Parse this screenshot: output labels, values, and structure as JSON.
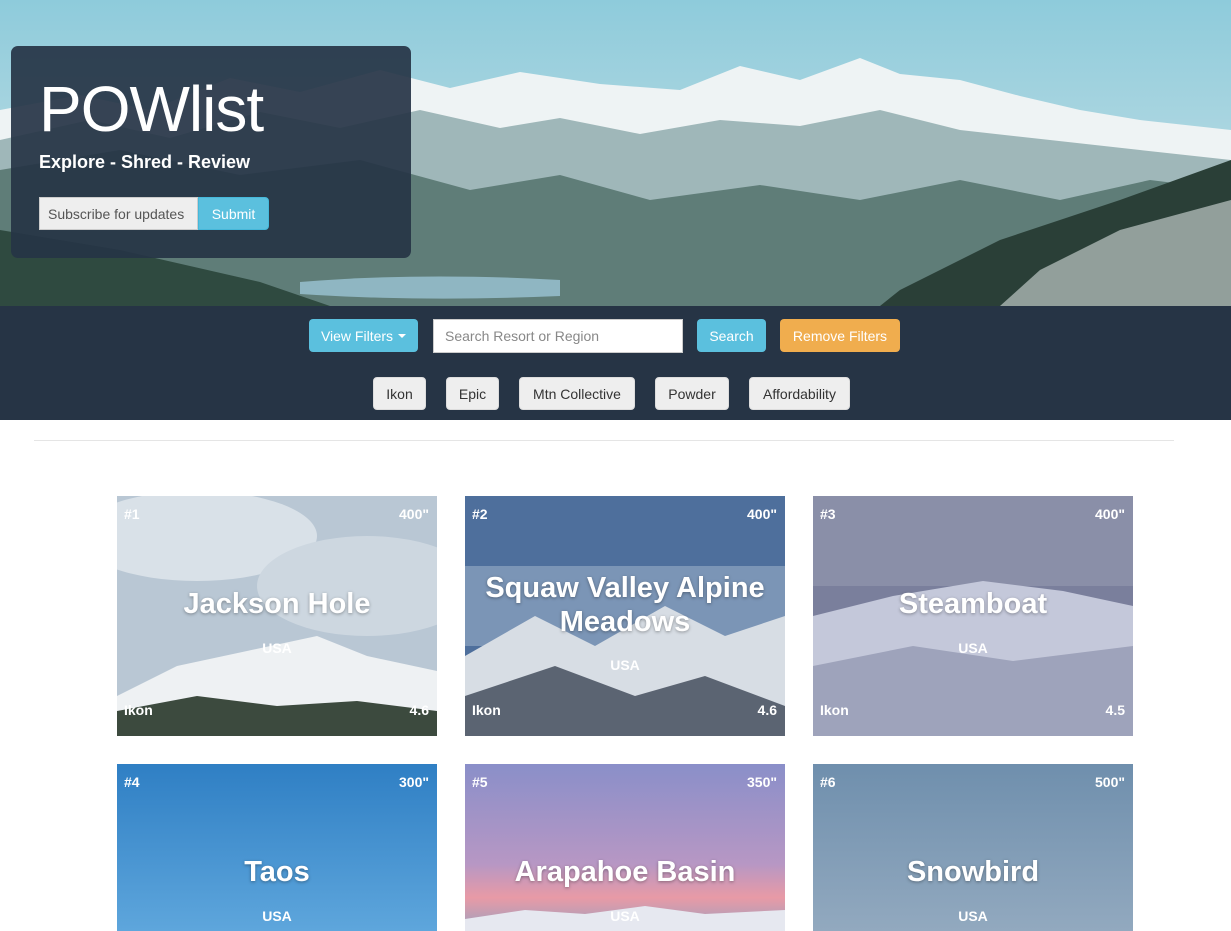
{
  "hero": {
    "title": "POWlist",
    "tagline": "Explore - Shred - Review",
    "subscribe_placeholder": "Subscribe for updates",
    "submit_label": "Submit"
  },
  "filters": {
    "view_filters_label": "View Filters",
    "search_placeholder": "Search Resort or Region",
    "search_label": "Search",
    "remove_label": "Remove Filters",
    "chips": [
      "Ikon",
      "Epic",
      "Mtn Collective",
      "Powder",
      "Affordability"
    ]
  },
  "resorts": [
    {
      "rank": "#1",
      "snowfall": "400\"",
      "name": "Jackson Hole",
      "country": "USA",
      "pass": "Ikon",
      "rating": "4.6"
    },
    {
      "rank": "#2",
      "snowfall": "400\"",
      "name": "Squaw Valley Alpine Meadows",
      "country": "USA",
      "pass": "Ikon",
      "rating": "4.6"
    },
    {
      "rank": "#3",
      "snowfall": "400\"",
      "name": "Steamboat",
      "country": "USA",
      "pass": "Ikon",
      "rating": "4.5"
    },
    {
      "rank": "#4",
      "snowfall": "300\"",
      "name": "Taos",
      "country": "USA",
      "pass": "",
      "rating": ""
    },
    {
      "rank": "#5",
      "snowfall": "350\"",
      "name": "Arapahoe Basin",
      "country": "USA",
      "pass": "",
      "rating": ""
    },
    {
      "rank": "#6",
      "snowfall": "500\"",
      "name": "Snowbird",
      "country": "USA",
      "pass": "",
      "rating": ""
    }
  ],
  "colors": {
    "navy": "#263445",
    "info": "#5bc0de",
    "warning": "#f0ad4e"
  }
}
